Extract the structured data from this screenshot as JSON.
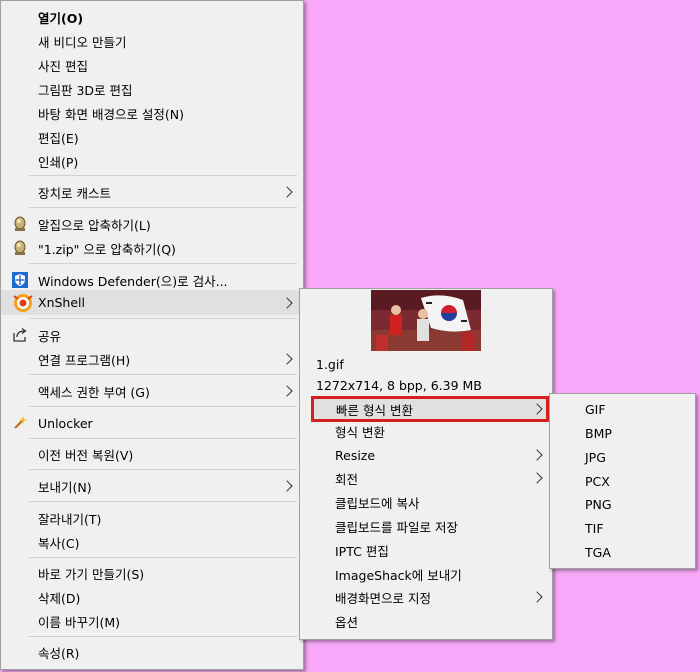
{
  "main_menu": {
    "open": "열기(O)",
    "new_video": "새 비디오 만들기",
    "edit_photo": "사진 편집",
    "paint3d": "그림판 3D로 편집",
    "set_wallpaper": "바탕 화면 배경으로 설정(N)",
    "edit": "편집(E)",
    "print": "인쇄(P)",
    "cast": "장치로 캐스트",
    "alzip": "알집으로 압축하기(L)",
    "alzip_named": "\"1.zip\" 으로 압축하기(Q)",
    "defender": "Windows Defender(으)로 검사...",
    "xnshell": "XnShell",
    "share": "공유",
    "open_with": "연결 프로그램(H)",
    "give_access": "액세스 권한 부여 (G)",
    "unlocker": "Unlocker",
    "restore": "이전 버전 복원(V)",
    "send_to": "보내기(N)",
    "cut": "잘라내기(T)",
    "copy": "복사(C)",
    "shortcut": "바로 가기 만들기(S)",
    "delete": "삭제(D)",
    "rename": "이름 바꾸기(M)",
    "properties": "속성(R)"
  },
  "xn_menu": {
    "file_name": "1.gif",
    "file_info": "1272x714, 8 bpp, 6.39 MB",
    "quick_convert": "빠른 형식 변환",
    "convert": "형식 변환",
    "resize": "Resize",
    "rotate": "회전",
    "copy_clipboard": "클립보드에 복사",
    "clipboard_to_file": "클립보드를 파일로 저장",
    "iptc": "IPTC 편집",
    "imageshack": "ImageShack에 보내기",
    "set_wallpaper": "배경화면으로 지정",
    "options": "옵션"
  },
  "formats": [
    "GIF",
    "BMP",
    "JPG",
    "PCX",
    "PNG",
    "TIF",
    "TGA"
  ],
  "colors": {
    "background": "#f8a8f8",
    "menu_bg": "#f0f0f0",
    "highlight_border": "#d42020"
  }
}
